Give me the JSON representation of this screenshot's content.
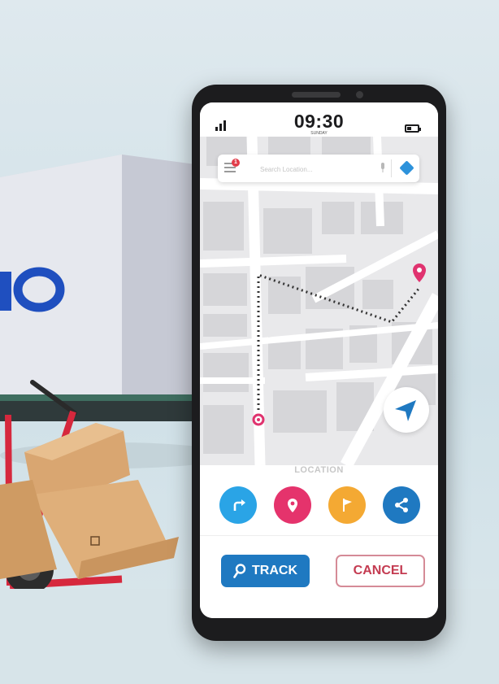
{
  "status_bar": {
    "time": "09:30",
    "subtitle": "SUNDAY"
  },
  "search": {
    "placeholder": "Search Location...",
    "notification_count": "1"
  },
  "panel": {
    "label": "LOCATION"
  },
  "actions": [
    {
      "icon": "turn-right-icon",
      "color": "#2aa4e6"
    },
    {
      "icon": "location-pin-icon",
      "color": "#e5336c"
    },
    {
      "icon": "flag-icon",
      "color": "#f4a933"
    },
    {
      "icon": "share-icon",
      "color": "#1f79c1"
    }
  ],
  "buttons": {
    "track_label": "TRACK",
    "cancel_label": "CANCEL"
  },
  "colors": {
    "route": "#333333",
    "pin": "#e0336f",
    "navigate": "#1f79c1",
    "track": "#1f79c1",
    "cancel": "#c43b51"
  }
}
